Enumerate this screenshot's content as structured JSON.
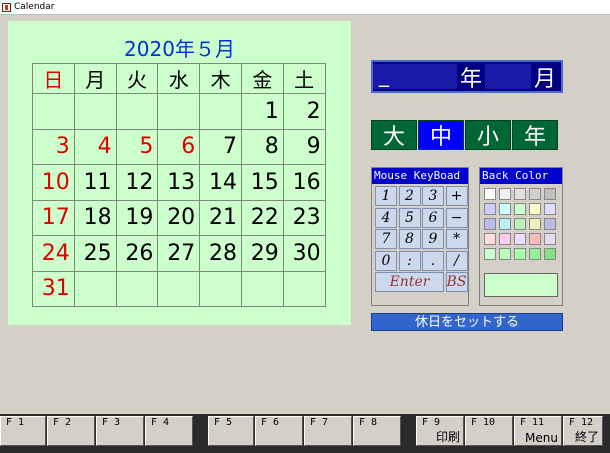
{
  "window": {
    "title": "Calendar"
  },
  "calendar": {
    "title": "2020年５月",
    "weekdays": [
      "日",
      "月",
      "火",
      "水",
      "木",
      "金",
      "土"
    ],
    "weeks": [
      [
        "",
        "",
        "",
        "",
        "",
        "1",
        "2"
      ],
      [
        "3",
        "4",
        "5",
        "6",
        "7",
        "8",
        "9"
      ],
      [
        "10",
        "11",
        "12",
        "13",
        "14",
        "15",
        "16"
      ],
      [
        "17",
        "18",
        "19",
        "20",
        "21",
        "22",
        "23"
      ],
      [
        "24",
        "25",
        "26",
        "27",
        "28",
        "29",
        "30"
      ],
      [
        "31",
        "",
        "",
        "",
        "",
        "",
        ""
      ]
    ],
    "red_cells": [
      [
        1,
        0
      ],
      [
        1,
        1
      ],
      [
        1,
        2
      ],
      [
        1,
        3
      ],
      [
        2,
        0
      ],
      [
        3,
        0
      ],
      [
        4,
        0
      ],
      [
        5,
        0
      ]
    ],
    "colors": {
      "panel_bg": "#ccffcc",
      "title": "#0033cc",
      "holiday": "#e00000"
    }
  },
  "year_month_input": {
    "year_value": "_",
    "month_value": "",
    "year_unit": "年",
    "month_unit": "月"
  },
  "size_buttons": [
    {
      "label": "大",
      "active": false
    },
    {
      "label": "中",
      "active": true
    },
    {
      "label": "小",
      "active": false
    },
    {
      "label": "年",
      "active": false
    }
  ],
  "mouse_keyboard": {
    "title": "Mouse KeyBoad",
    "keys": [
      "1",
      "2",
      "3",
      "+",
      "4",
      "5",
      "6",
      "−",
      "7",
      "8",
      "9",
      "*",
      "0",
      ":",
      ".",
      "/"
    ],
    "enter_label": "Enter",
    "bs_label": "BS"
  },
  "back_color": {
    "title": "Back Color",
    "swatches": [
      "#ffffff",
      "#f0f0f0",
      "#e0e0e0",
      "#d0d0d0",
      "#c0c0c0",
      "#ccccff",
      "#ccffff",
      "#ccffcc",
      "#ffffcc",
      "#ddddff",
      "#bbbbee",
      "#bbeeee",
      "#bbeebb",
      "#eeeebb",
      "#bbbbdd",
      "#ffdddd",
      "#ffccee",
      "#eeddff",
      "#ffbbbb",
      "#ddddee",
      "#ccffcc",
      "#bbffbb",
      "#aaffaa",
      "#99ee99",
      "#88dd88"
    ],
    "selected": "#ccffcc"
  },
  "holiday_button": {
    "label": "休日をセットする"
  },
  "function_keys": [
    {
      "key": "F 1",
      "label": ""
    },
    {
      "key": "F 2",
      "label": ""
    },
    {
      "key": "F 3",
      "label": ""
    },
    {
      "key": "F 4",
      "label": ""
    },
    {
      "key": "F 5",
      "label": ""
    },
    {
      "key": "F 6",
      "label": ""
    },
    {
      "key": "F 7",
      "label": ""
    },
    {
      "key": "F 8",
      "label": ""
    },
    {
      "key": "F 9",
      "label": "印刷"
    },
    {
      "key": "F 10",
      "label": ""
    },
    {
      "key": "F 11",
      "label": "Menu"
    },
    {
      "key": "F 12",
      "label": "終了"
    }
  ]
}
